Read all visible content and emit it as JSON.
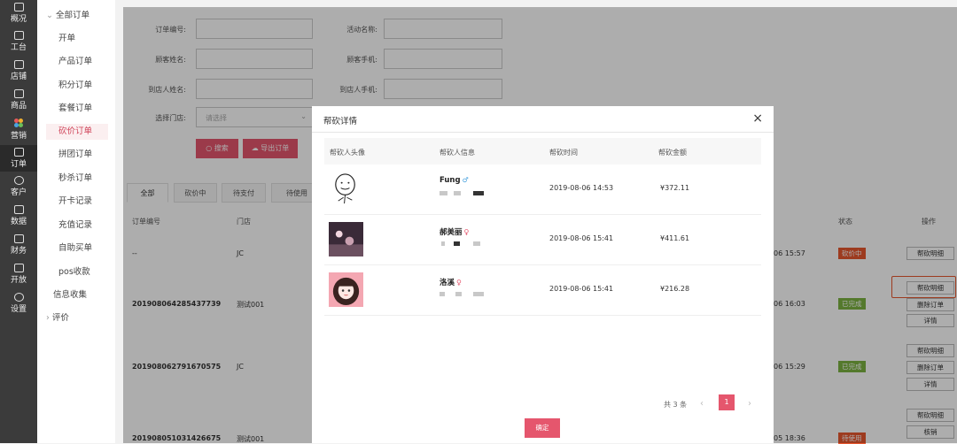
{
  "rail": [
    {
      "label": "概况",
      "icon": "monitor-icon"
    },
    {
      "label": "工台",
      "icon": "desktop-icon"
    },
    {
      "label": "店铺",
      "icon": "store-icon"
    },
    {
      "label": "商品",
      "icon": "bag-icon"
    },
    {
      "label": "营销",
      "icon": "flower-icon"
    },
    {
      "label": "订单",
      "icon": "order-icon"
    },
    {
      "label": "客户",
      "icon": "user-icon"
    },
    {
      "label": "数据",
      "icon": "chart-icon"
    },
    {
      "label": "财务",
      "icon": "finance-icon"
    },
    {
      "label": "开放",
      "icon": "open-icon"
    },
    {
      "label": "设置",
      "icon": "gear-icon"
    }
  ],
  "sidebar": {
    "group_all": "全部订单",
    "items": [
      "开单",
      "产品订单",
      "积分订单",
      "套餐订单",
      "砍价订单",
      "拼团订单",
      "秒杀订单",
      "开卡记录",
      "充值记录",
      "自助买单",
      "pos收款"
    ],
    "info": "信息收集",
    "review": "评价",
    "active": "砍价订单"
  },
  "filters": {
    "order_no": "订单编号:",
    "activity": "活动名称:",
    "customer_name": "顾客姓名:",
    "customer_phone": "顾客手机:",
    "visitor_name": "到店人姓名:",
    "visitor_phone": "到店人手机:",
    "store": "选择门店:",
    "store_placeholder": "请选择",
    "search": "搜索",
    "export": "导出订单"
  },
  "tabs": [
    "全部",
    "砍价中",
    "待支付",
    "待使用"
  ],
  "table": {
    "col_order": "订单编号",
    "col_store": "门店",
    "col_status": "状态",
    "col_op": "操作",
    "rows": [
      {
        "order": "--",
        "store": "JC",
        "time": "06 15:57",
        "status": "砍价中"
      },
      {
        "order": "201908064285437739",
        "store": "测试001",
        "time": "06 16:03",
        "status": "已完成"
      },
      {
        "order": "201908062791670575",
        "store": "JC",
        "time": "06 15:29",
        "status": "已完成"
      },
      {
        "order": "201908051031426675",
        "store": "测试001",
        "time": "05 18:36",
        "status": "待使用"
      }
    ],
    "op_detail_bargain": "帮砍明细",
    "op_delete": "删除订单",
    "op_detail": "详情",
    "op_verify": "核销"
  },
  "modal": {
    "title": "帮砍详情",
    "close": "×",
    "headers": [
      "帮砍人头像",
      "帮砍人信息",
      "帮砍时间",
      "帮砍金额"
    ],
    "rows": [
      {
        "name": "Fung",
        "gender": "♂",
        "time": "2019-08-06 14:53",
        "amount": "¥372.11"
      },
      {
        "name": "郝美丽",
        "gender": "♀",
        "time": "2019-08-06 15:41",
        "amount": "¥411.61"
      },
      {
        "name": "洛溪",
        "gender": "♀",
        "time": "2019-08-06 15:41",
        "amount": "¥216.28"
      }
    ],
    "total": "共 3 条",
    "prev": "‹",
    "next": "›",
    "page": "1",
    "ok": "确定"
  },
  "colors": {
    "accent": "#e5566d",
    "done": "#7cb342",
    "bargaining": "#e8572f",
    "pending": "#e8572f"
  }
}
